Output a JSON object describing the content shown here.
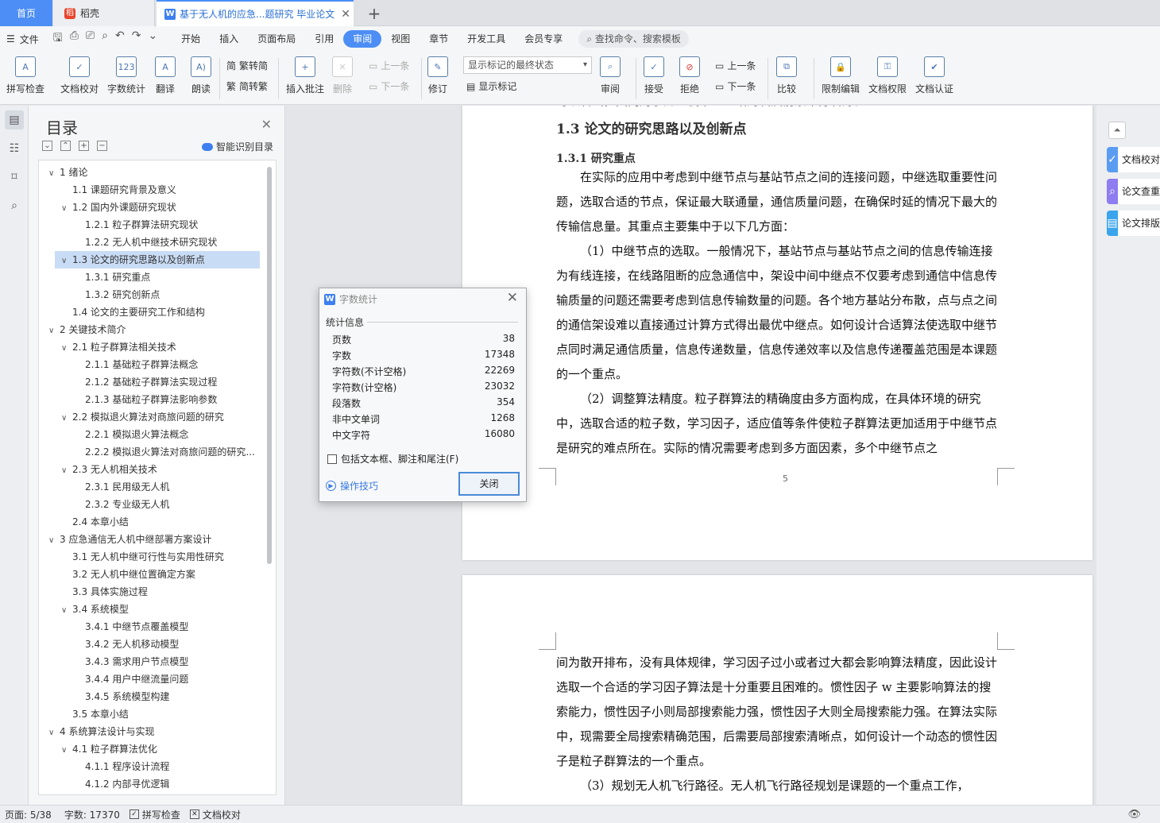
{
  "tabs": {
    "home": "首页",
    "daoke": "稻壳",
    "doc": "基于无人机的应急...题研究 毕业论文",
    "add": "+"
  },
  "menubar": {
    "file": "文件",
    "items": [
      "开始",
      "插入",
      "页面布局",
      "引用",
      "审阅",
      "视图",
      "章节",
      "开发工具",
      "会员专享"
    ],
    "active": "审阅",
    "search": "查找命令、搜索模板"
  },
  "ribbon": {
    "spell": "拼写检查",
    "proof": "文档校对",
    "wordcount": "字数统计",
    "translate": "翻译",
    "read": "朗读",
    "trad": "繁转简",
    "simp": "简转繁",
    "insert_comment": "插入批注",
    "delete": "删除",
    "prev_comment": "上一条",
    "next_comment": "下一条",
    "revise": "修订",
    "track_mode": "显示标记的最终状态",
    "show_marks": "显示标记",
    "review": "审阅",
    "accept": "接受",
    "reject": "拒绝",
    "prev_change": "上一条",
    "next_change": "下一条",
    "compare": "比较",
    "restrict": "限制编辑",
    "permission": "文档权限",
    "certify": "文档认证"
  },
  "nav": {
    "title": "目录",
    "smart": "智能识别目录",
    "items": [
      {
        "level": 1,
        "arrow": "∨",
        "text": "1 绪论"
      },
      {
        "level": 2,
        "arrow": "",
        "text": "1.1 课题研究背景及意义"
      },
      {
        "level": 2,
        "arrow": "∨",
        "text": "1.2 国内外课题研究现状"
      },
      {
        "level": 3,
        "arrow": "",
        "text": "1.2.1 粒子群算法研究现状"
      },
      {
        "level": 3,
        "arrow": "",
        "text": "1.2.2 无人机中继技术研究现状"
      },
      {
        "level": 2,
        "arrow": "∨",
        "text": "1.3 论文的研究思路以及创新点",
        "sel": true
      },
      {
        "level": 3,
        "arrow": "",
        "text": "1.3.1 研究重点"
      },
      {
        "level": 3,
        "arrow": "",
        "text": "1.3.2 研究创新点"
      },
      {
        "level": 2,
        "arrow": "",
        "text": "1.4 论文的主要研究工作和结构"
      },
      {
        "level": 1,
        "arrow": "∨",
        "text": "2 关键技术简介"
      },
      {
        "level": 2,
        "arrow": "∨",
        "text": "2.1 粒子群算法相关技术"
      },
      {
        "level": 3,
        "arrow": "",
        "text": "2.1.1 基础粒子群算法概念"
      },
      {
        "level": 3,
        "arrow": "",
        "text": "2.1.2 基础粒子群算法实现过程"
      },
      {
        "level": 3,
        "arrow": "",
        "text": "2.1.3 基础粒子群算法影响参数"
      },
      {
        "level": 2,
        "arrow": "∨",
        "text": "2.2 模拟退火算法对商旅问题的研究"
      },
      {
        "level": 3,
        "arrow": "",
        "text": "2.2.1 模拟退火算法概念"
      },
      {
        "level": 3,
        "arrow": "",
        "text": "2.2.2 模拟退火算法对商旅问题的研究..."
      },
      {
        "level": 2,
        "arrow": "∨",
        "text": "2.3 无人机相关技术"
      },
      {
        "level": 3,
        "arrow": "",
        "text": "2.3.1 民用级无人机"
      },
      {
        "level": 3,
        "arrow": "",
        "text": "2.3.2 专业级无人机"
      },
      {
        "level": 2,
        "arrow": "",
        "text": "2.4 本章小结"
      },
      {
        "level": 1,
        "arrow": "∨",
        "text": "3 应急通信无人机中继部署方案设计"
      },
      {
        "level": 2,
        "arrow": "",
        "text": "3.1 无人机中继可行性与实用性研究"
      },
      {
        "level": 2,
        "arrow": "",
        "text": "3.2 无人机中继位置确定方案"
      },
      {
        "level": 2,
        "arrow": "",
        "text": "3.3 具体实施过程"
      },
      {
        "level": 2,
        "arrow": "∨",
        "text": "3.4 系统模型"
      },
      {
        "level": 3,
        "arrow": "",
        "text": "3.4.1  中继节点覆盖模型"
      },
      {
        "level": 3,
        "arrow": "",
        "text": "3.4.2 无人机移动模型"
      },
      {
        "level": 3,
        "arrow": "",
        "text": "3.4.3 需求用户节点模型"
      },
      {
        "level": 3,
        "arrow": "",
        "text": "3.4.4  用户中继流量问题"
      },
      {
        "level": 3,
        "arrow": "",
        "text": "3.4.5  系统模型构建"
      },
      {
        "level": 2,
        "arrow": "",
        "text": "3.5 本章小结"
      },
      {
        "level": 1,
        "arrow": "∨",
        "text": "4 系统算法设计与实现"
      },
      {
        "level": 2,
        "arrow": "∨",
        "text": "4.1 粒子群算法优化"
      },
      {
        "level": 3,
        "arrow": "",
        "text": "4.1.1 程序设计流程"
      },
      {
        "level": 3,
        "arrow": "",
        "text": "4.1.2    内部寻优逻辑"
      }
    ]
  },
  "doc": {
    "top_cut": "可以看出，国内对于无人机中继基站的发展前景十分看好。",
    "h2": "1.3 论文的研究思路以及创新点",
    "h3": "1.3.1 研究重点",
    "p1": "在实际的应用中考虑到中继节点与基站节点之间的连接问题，中继选取重要性问题，选取合适的节点，保证最大联通量，通信质量问题，在确保时延的情况下最大的传输信息量。其重点主要集中于以下几方面：",
    "p2": "（1）中继节点的选取。一般情况下，基站节点与基站节点之间的信息传输连接为有线连接，在线路阻断的应急通信中，架设中间中继点不仅要考虑到通信中信息传输质量的问题还需要考虑到信息传输数量的问题。各个地方基站分布散，点与点之间的通信架设难以直接通过计算方式得出最优中继点。如何设计合适算法使选取中继节点同时满足通信质量，信息传递数量，信息传递效率以及信息传递覆盖范围是本课题的一个重点。",
    "p3": "（2）调整算法精度。粒子群算法的精确度由多方面构成，在具体环境的研究中，选取合适的粒子数，学习因子，适应值等条件使粒子群算法更加适用于中继节点是研究的难点所在。实际的情况需要考虑到多方面因素，多个中继节点之",
    "page_num": "5",
    "p4": "间为散开排布，没有具体规律，学习因子过小或者过大都会影响算法精度，因此设计选取一个合适的学习因子算法是十分重要且困难的。惯性因子 w 主要影响算法的搜索能力，惯性因子小则局部搜索能力强，惯性因子大则全局搜索能力强。在算法实际中，现需要全局搜索精确范围，后需要局部搜索清晰点，如何设计一个动态的惯性因子是粒子群算法的一个重点。",
    "p5": "（3）规划无人机飞行路径。无人机飞行路径规划是课题的一个重点工作，"
  },
  "right": {
    "b1": "文档校对",
    "b2": "论文查重",
    "b3": "论文排版"
  },
  "dialog": {
    "title": "字数统计",
    "group": "统计信息",
    "rows": [
      {
        "k": "页数",
        "v": "38"
      },
      {
        "k": "字数",
        "v": "17348"
      },
      {
        "k": "字符数(不计空格)",
        "v": "22269"
      },
      {
        "k": "字符数(计空格)",
        "v": "23032"
      },
      {
        "k": "段落数",
        "v": "354"
      },
      {
        "k": "非中文单词",
        "v": "1268"
      },
      {
        "k": "中文字符",
        "v": "16080"
      }
    ],
    "include": "包括文本框、脚注和尾注(F)",
    "tips": "操作技巧",
    "close": "关闭"
  },
  "status": {
    "page": "页面: 5/38",
    "words": "字数: 17370",
    "spell": "拼写检查",
    "proof": "文档校对"
  }
}
